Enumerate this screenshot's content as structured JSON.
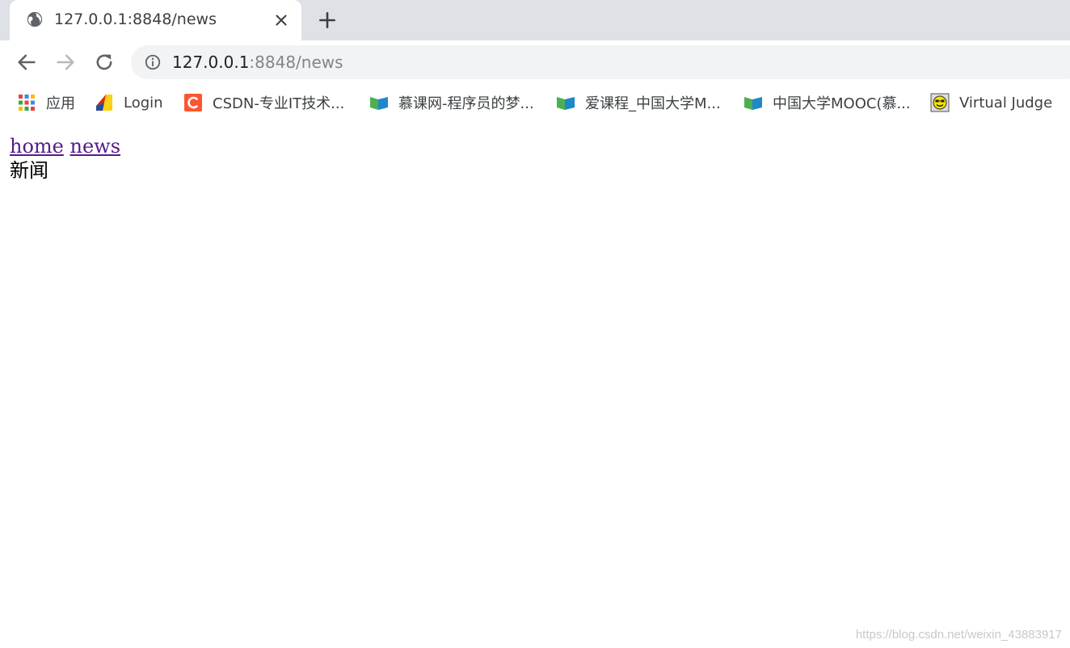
{
  "tab": {
    "title": "127.0.0.1:8848/news"
  },
  "address": {
    "host": "127.0.0.1",
    "rest": ":8848/news"
  },
  "bookmarks": [
    {
      "label": "应用",
      "icon": "apps-grid-icon"
    },
    {
      "label": "Login",
      "icon": "login-favicon-icon"
    },
    {
      "label": "CSDN-专业IT技术...",
      "icon": "csdn-favicon-icon"
    },
    {
      "label": "慕课网-程序员的梦...",
      "icon": "book-favicon-icon"
    },
    {
      "label": "爱课程_中国大学M...",
      "icon": "book-favicon-icon"
    },
    {
      "label": "中国大学MOOC(慕...",
      "icon": "book-favicon-icon"
    },
    {
      "label": "Virtual Judge",
      "icon": "smiley-favicon-icon"
    }
  ],
  "page": {
    "links": [
      "home",
      "news"
    ],
    "text": "新闻"
  },
  "watermark": "https://blog.csdn.net/weixin_43883917",
  "colors": {
    "tabstrip": "#dee1e6",
    "link_visited": "#551a8b",
    "omnibox": "#f1f3f4"
  }
}
